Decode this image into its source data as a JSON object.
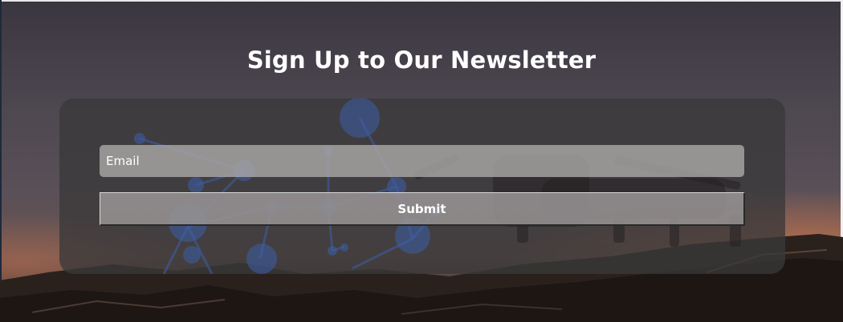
{
  "page": {
    "title": "Sign Up to Our Newsletter"
  },
  "form": {
    "email_placeholder": "Email",
    "email_value": "",
    "submit_label": "Submit"
  },
  "colors": {
    "title_text": "#ffffff",
    "card_bg": "#3a383a",
    "input_bg": "#aaa6a6",
    "button_bg": "#969292",
    "network_blue": "#3d5fa8",
    "sunset_glow": "#cc764e"
  }
}
